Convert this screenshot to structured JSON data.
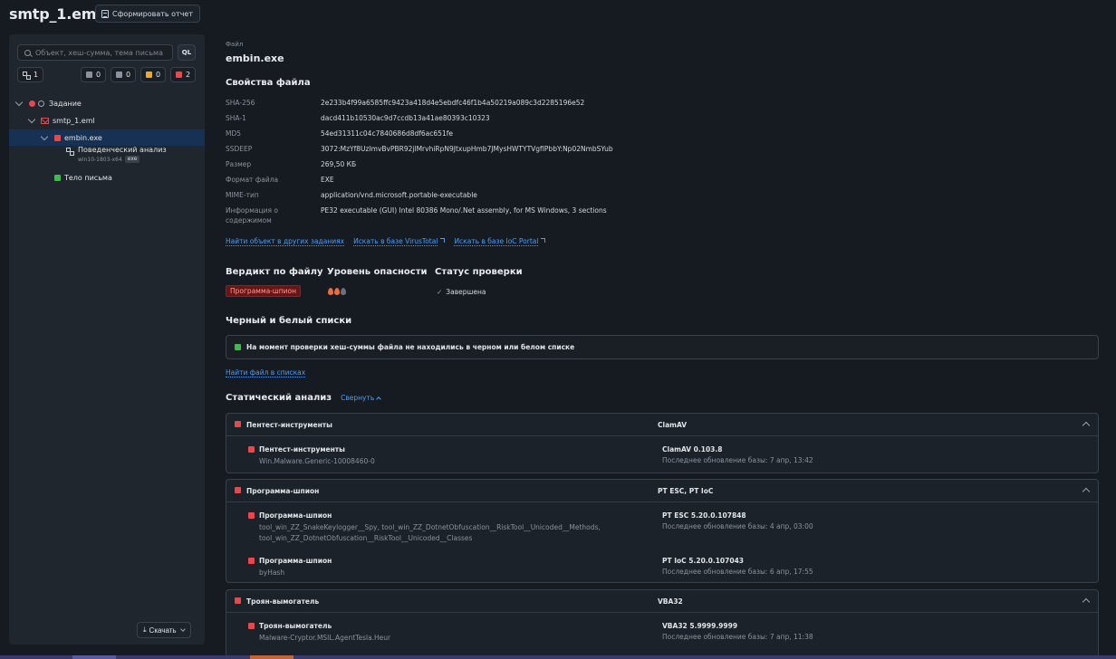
{
  "header": {
    "title": "smtp_1.eml",
    "report_button": "Сформировать отчет"
  },
  "sidebar": {
    "search_placeholder": "Объект, хеш-сумма, тема письма",
    "ql_button": "QL",
    "filters": [
      {
        "label": "1",
        "color": ""
      },
      {
        "label": "0",
        "color": "#8b929c"
      },
      {
        "label": "0",
        "color": "#8b929c"
      },
      {
        "label": "0",
        "color": "#f5a524"
      },
      {
        "label": "2",
        "color": "#e5484d"
      }
    ],
    "tree": {
      "task": "Задание",
      "email": "smtp_1.eml",
      "file": "embin.exe",
      "behavior": "Поведенческий анализ",
      "behavior_env": "win10-1803-x64",
      "behavior_tag": "exe",
      "body": "Тело письма"
    },
    "download_button": "Скачать"
  },
  "file": {
    "label": "Файл",
    "name": "embin.exe",
    "props_title": "Свойства файла",
    "props": [
      {
        "k": "SHA-256",
        "v": "2e233b4f99a6585ffc9423a418d4e5ebdfc46f1b4a50219a089c3d2285196e52"
      },
      {
        "k": "SHA-1",
        "v": "dacd411b10530ac9d7ccdb13a41ae80393c10323"
      },
      {
        "k": "MD5",
        "v": "54ed31311c04c7840686d8df6ac651fe"
      },
      {
        "k": "SSDEEP",
        "v": "3072:MzYf8UzImvBvPBR92jlMrvhiRpN9JtxupHmb7JMysHWTYTVgfIPbbY:Np02NmbSYub"
      },
      {
        "k": "Размер",
        "v": "269,50 КБ"
      },
      {
        "k": "Формат файла",
        "v": "EXE"
      },
      {
        "k": "MIME-тип",
        "v": "application/vnd.microsoft.portable-executable"
      },
      {
        "k": "Информация о содержимом",
        "v": "PE32 executable (GUI) Intel 80386 Mono/.Net assembly, for MS Windows, 3 sections"
      }
    ],
    "links": {
      "other_tasks": "Найти объект в других заданиях",
      "virustotal": "Искать в базе VirusTotal",
      "ioc_portal": "Искать в базе IoC Portal"
    }
  },
  "verdict": {
    "verdict_title": "Вердикт по файлу",
    "verdict_value": "Программа-шпион",
    "danger_title": "Уровень опасности",
    "danger_level": 2,
    "danger_max": 3,
    "status_title": "Статус проверки",
    "status_value": "Завершена"
  },
  "lists": {
    "title": "Черный и белый списки",
    "message": "На момент проверки хеш-суммы файла не находились в черном или белом списке",
    "link": "Найти файл в списках"
  },
  "static": {
    "title": "Статический анализ",
    "collapse": "Свернуть",
    "groups": [
      {
        "title": "Пентест-инструменты",
        "engines": "ClamAV",
        "details": [
          {
            "name": "Пентест-инструменты",
            "sig": "Win.Malware.Generic-10008460-0",
            "engine": "ClamAV 0.103.8",
            "updated": "Последнее обновление базы: 7 апр, 13:42"
          }
        ]
      },
      {
        "title": "Программа-шпион",
        "engines": "PT ESC, PT IoC",
        "details": [
          {
            "name": "Программа-шпион",
            "sig": "tool_win_ZZ_SnakeKeylogger__Spy, tool_win_ZZ_DotnetObfuscation__RiskTool__Unicoded__Methods, tool_win_ZZ_DotnetObfuscation__RiskTool__Unicoded__Classes",
            "engine": "PT ESC 5.20.0.107848",
            "updated": "Последнее обновление базы: 4 апр, 03:00"
          },
          {
            "name": "Программа-шпион",
            "sig": "byHash",
            "engine": "PT IoC 5.20.0.107043",
            "updated": "Последнее обновление базы: 6 апр, 17:55"
          }
        ]
      },
      {
        "title": "Троян-вымогатель",
        "engines": "VBA32",
        "details": [
          {
            "name": "Троян-вымогатель",
            "sig": "Malware-Cryptor.MSIL.AgentTesla.Heur",
            "engine": "VBA32 5.9999.9999",
            "updated": "Последнее обновление базы: 7 апр, 11:38"
          }
        ]
      }
    ]
  },
  "colors": {
    "accent": "#4b9cf5",
    "danger": "#e5484d",
    "ok": "#3fb950",
    "flame": "#f06a3a"
  }
}
